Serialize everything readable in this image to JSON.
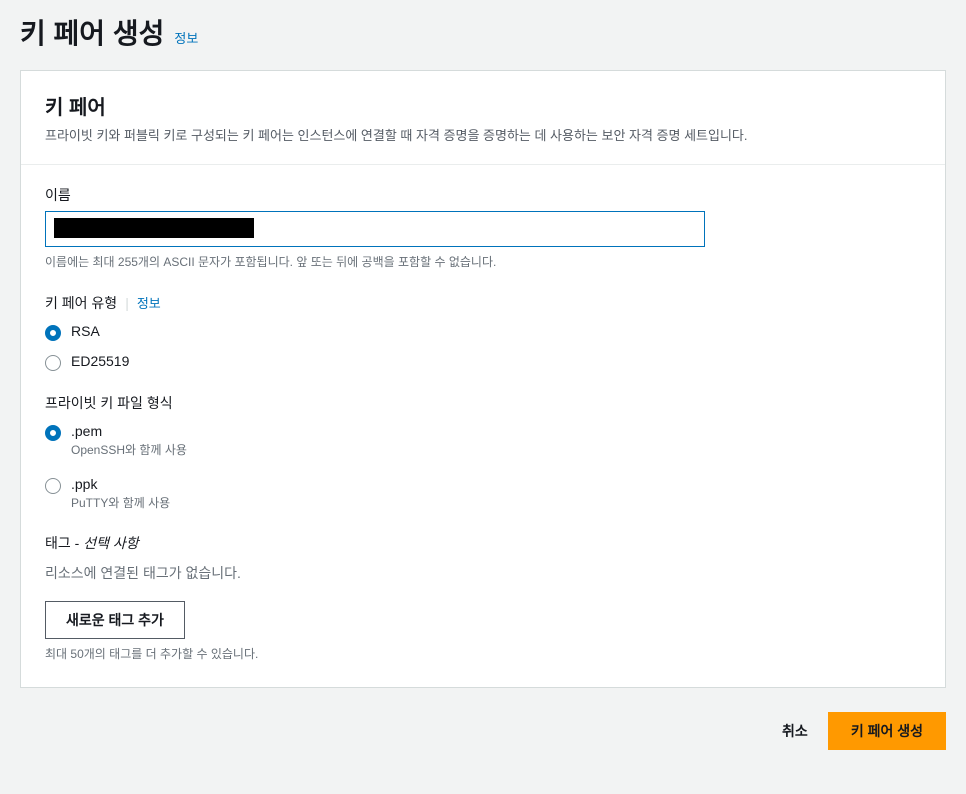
{
  "page": {
    "title": "키 페어 생성",
    "info_link": "정보"
  },
  "panel": {
    "title": "키 페어",
    "description": "프라이빗 키와 퍼블릭 키로 구성되는 키 페어는 인스턴스에 연결할 때 자격 증명을 증명하는 데 사용하는 보안 자격 증명 세트입니다."
  },
  "name_field": {
    "label": "이름",
    "hint": "이름에는 최대 255개의 ASCII 문자가 포함됩니다. 앞 또는 뒤에 공백을 포함할 수 없습니다."
  },
  "keypair_type": {
    "label": "키 페어 유형",
    "info_link": "정보",
    "options": [
      {
        "label": "RSA",
        "selected": true
      },
      {
        "label": "ED25519",
        "selected": false
      }
    ]
  },
  "file_format": {
    "label": "프라이빗 키 파일 형식",
    "options": [
      {
        "label": ".pem",
        "description": "OpenSSH와 함께 사용",
        "selected": true
      },
      {
        "label": ".ppk",
        "description": "PuTTY와 함께 사용",
        "selected": false
      }
    ]
  },
  "tags": {
    "label_prefix": "태그 - ",
    "label_suffix": "선택 사항",
    "empty_text": "리소스에 연결된 태그가 없습니다.",
    "add_button": "새로운 태그 추가",
    "limit_hint": "최대 50개의 태그를 더 추가할 수 있습니다."
  },
  "footer": {
    "cancel": "취소",
    "submit": "키 페어 생성"
  }
}
